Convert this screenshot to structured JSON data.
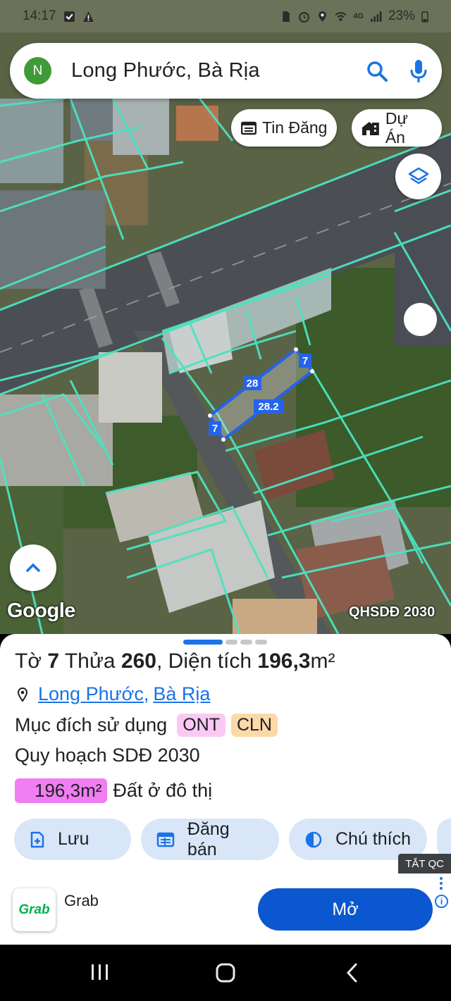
{
  "status_bar": {
    "time": "14:17",
    "battery": "23%",
    "network": "4G"
  },
  "search": {
    "avatar_letter": "N",
    "query": "Long Phước, Bà Rịa"
  },
  "map_chips": {
    "listings": "Tin Đăng",
    "projects": "Dự Án"
  },
  "map": {
    "google_label": "Google",
    "plan_label": "QHSDĐ 2030",
    "dimensions": {
      "top": "28",
      "right": "7",
      "bottom": "28.2",
      "left": "7"
    },
    "colors": {
      "parcel_line": "#4be3c0",
      "selected_parcel": "#2563eb"
    }
  },
  "parcel": {
    "sheet_prefix": "Tờ ",
    "sheet_no": "7",
    "plot_prefix": " Thửa ",
    "plot_no": "260",
    "area_prefix": ", Diện tích ",
    "area_value": "196,3",
    "area_unit": "m²",
    "location_ward": "Long Phước",
    "location_separator": ",",
    "location_city": "Bà Rịa",
    "purpose_label": "Mục đích sử dụng",
    "purpose_tags": [
      {
        "code": "ONT",
        "color": "#f9c9f3"
      },
      {
        "code": "CLN",
        "color": "#fbd9a8"
      }
    ],
    "plan_label": "Quy hoạch SDĐ 2030",
    "plan_area": "196,3m²",
    "plan_use": "Đất ở đô thị"
  },
  "actions": {
    "save": "Lưu",
    "post_sale": "Đăng bán",
    "legend": "Chú thích"
  },
  "ad": {
    "close_label": "TẮT QC",
    "logo_text": "Grab",
    "app_name": "Grab",
    "open_label": "Mở",
    "info_icon": "i"
  }
}
